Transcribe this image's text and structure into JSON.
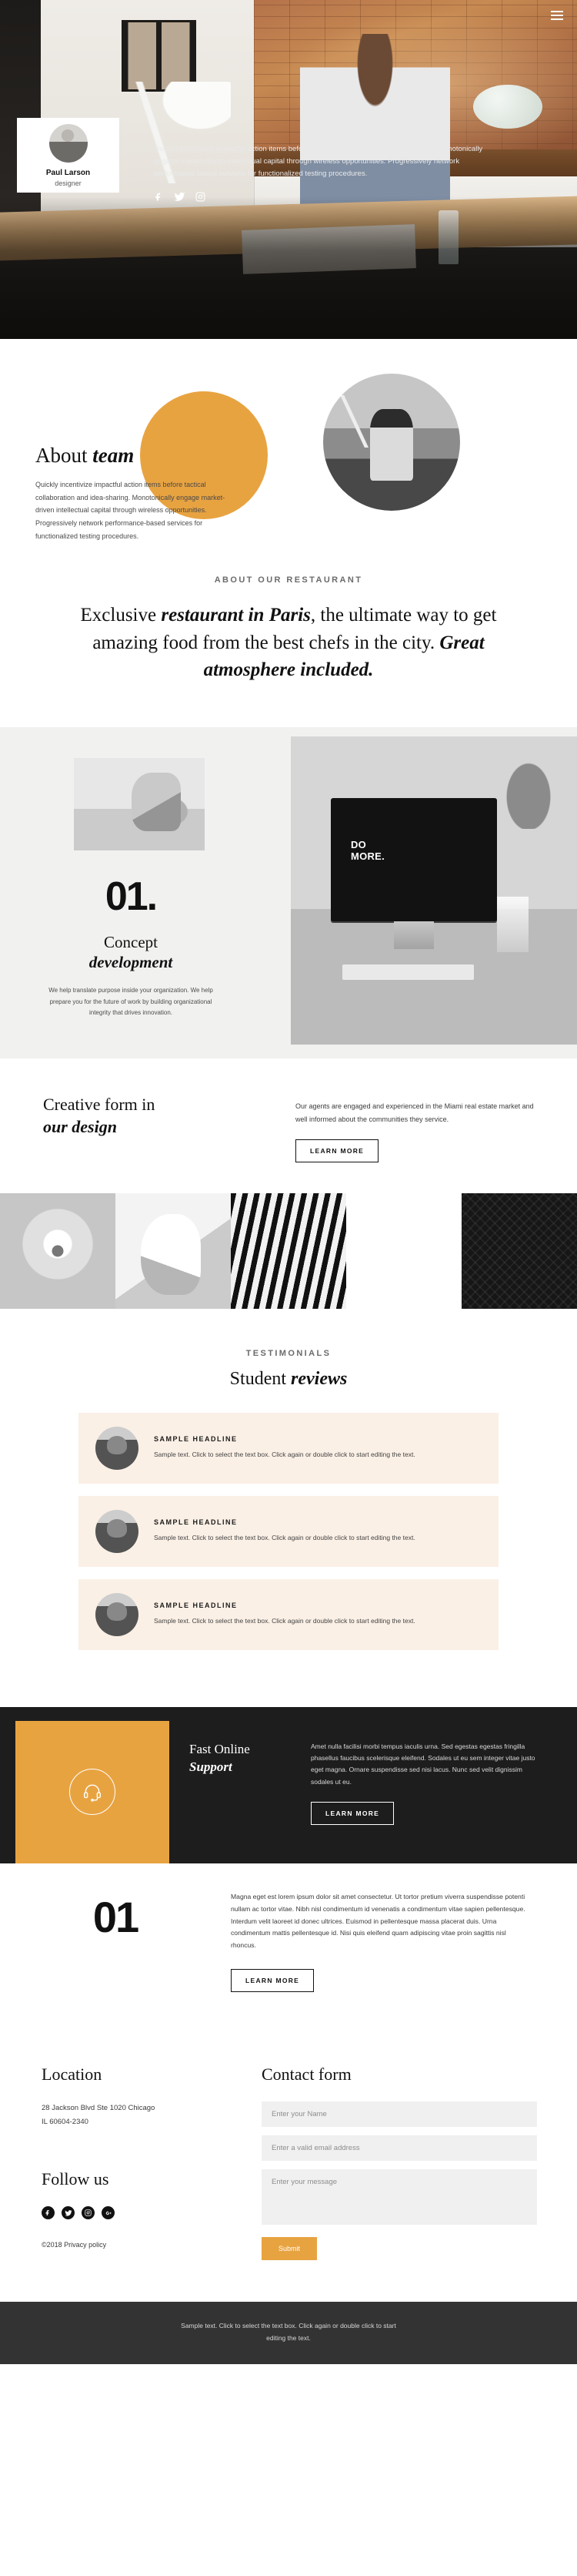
{
  "hero": {
    "menu_icon": "hamburger-menu-icon",
    "card": {
      "name": "Paul Larson",
      "role": "designer"
    },
    "paragraph": "Quickly incentivize impactful action items before tactical collaboration and idea-sharing. Monotonically engage market-driven intellectual capital through wireless opportunities. Progressively network performance based services for functionalized testing procedures.",
    "social": [
      "facebook-icon",
      "twitter-icon",
      "instagram-icon"
    ]
  },
  "about": {
    "title_plain": "About ",
    "title_em": "team",
    "paragraph": "Quickly incentivize impactful action items before tactical collaboration and idea-sharing. Monotonically engage market-driven intellectual capital through wireless opportunities. Progressively network performance-based services for functionalized testing procedures."
  },
  "statement": {
    "eyebrow": "ABOUT OUR RESTAURANT",
    "line1_plain": "Exclusive ",
    "line1_em": "restaurant in Paris",
    "line1_rest": ", the ultimate way to get amazing food from the best chefs in the city. ",
    "line2_em": "Great atmosphere included."
  },
  "concept": {
    "number": "01.",
    "title_plain": "Concept",
    "title_em": "development",
    "paragraph": "We help translate purpose inside your organization. We help prepare you for the future of work by building organizational integrity that drives innovation.",
    "screen_text_line1": "DO",
    "screen_text_line2": "MORE."
  },
  "creative": {
    "title_plain": "Creative form in",
    "title_em": "our design",
    "paragraph": "Our agents are engaged and experienced in the Miami real estate market and well informed about the communities they service.",
    "button": "LEARN MORE"
  },
  "testimonials": {
    "eyebrow": "TESTIMONIALS",
    "title_plain": "Student ",
    "title_em": "reviews",
    "items": [
      {
        "headline": "SAMPLE HEADLINE",
        "text": "Sample text. Click to select the text box. Click again or double click to start editing the text."
      },
      {
        "headline": "SAMPLE HEADLINE",
        "text": "Sample text. Click to select the text box. Click again or double click to start editing the text."
      },
      {
        "headline": "SAMPLE HEADLINE",
        "text": "Sample text. Click to select the text box. Click again or double click to start editing the text."
      }
    ]
  },
  "support": {
    "icon": "headset-icon",
    "title_plain": "Fast Online",
    "title_em": "Support",
    "paragraph": "Amet nulla facilisi morbi tempus iaculis urna. Sed egestas egestas fringilla phasellus faucibus scelerisque eleifend. Sodales ut eu sem integer vitae justo eget magna. Ornare suspendisse sed nisi lacus. Nunc sed velit dignissim sodales ut eu.",
    "button": "LEARN MORE"
  },
  "block01": {
    "number": "01",
    "paragraph": "Magna eget est lorem ipsum dolor sit amet consectetur. Ut tortor pretium viverra suspendisse potenti nullam ac tortor vitae. Nibh nisl condimentum id venenatis a condimentum vitae sapien pellentesque. Interdum velit laoreet id donec ultrices. Euismod in pellentesque massa placerat duis. Urna condimentum mattis pellentesque id. Nisi quis eleifend quam adipiscing vitae proin sagittis nisl rhoncus.",
    "button": "LEARN MORE"
  },
  "footer": {
    "location_title": "Location",
    "address_line1": "28 Jackson Blvd Ste 1020 Chicago",
    "address_line2": "IL 60604-2340",
    "follow_title": "Follow us",
    "social": [
      "facebook-icon",
      "twitter-icon",
      "instagram-icon",
      "google-plus-icon"
    ],
    "copyright": "©2018 Privacy policy",
    "contact_title": "Contact form",
    "name_placeholder": "Enter your Name",
    "email_placeholder": "Enter a valid email address",
    "message_placeholder": "Enter your message",
    "submit_label": "Submit"
  },
  "bottom_bar": {
    "text": "Sample text. Click to select the text box. Click again or double click to start editing the text."
  },
  "colors": {
    "accent": "#e8a341",
    "dark": "#1d1d1d",
    "cream": "#fbf0e6",
    "bottom_bar": "#333333"
  }
}
